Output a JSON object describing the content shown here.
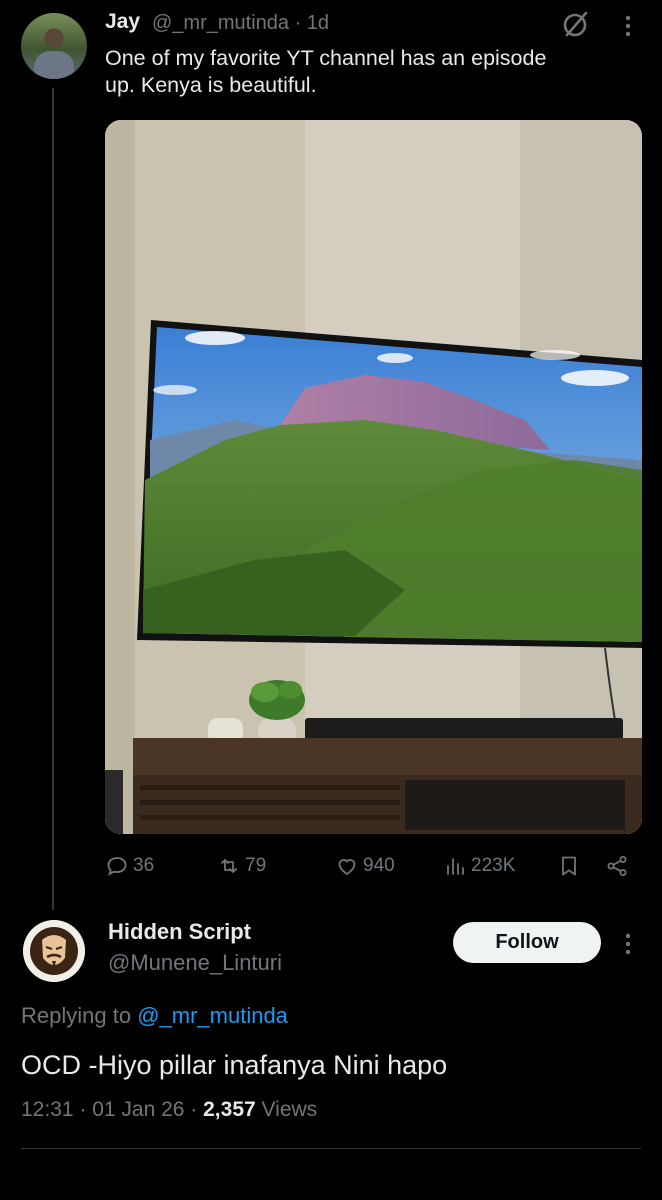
{
  "tweet": {
    "author_name": "Jay",
    "handle_time": "@_mr_mutinda · 1d",
    "text": "One of my favorite YT channel has an episode\nup.  Kenya is beautiful.",
    "icons": {
      "grok": "grok-slash-icon",
      "more": "more-vertical-icon"
    },
    "stats": {
      "replies": "36",
      "reposts": "79",
      "likes": "940",
      "views": "223K"
    }
  },
  "reply": {
    "author_name": "Hidden Script",
    "handle": "@Munene_Linturi",
    "follow_label": "Follow",
    "replying_prefix": "Replying to ",
    "replying_mention": "@_mr_mutinda",
    "text": "OCD -Hiyo pillar inafanya Nini hapo",
    "time_date": "12:31 · 01 Jan 26 · ",
    "views_count": "2,357",
    "views_label": " Views"
  },
  "colors": {
    "background": "#000000",
    "text": "#e7e9ea",
    "muted": "#71767b",
    "accent": "#1d9bf0"
  }
}
